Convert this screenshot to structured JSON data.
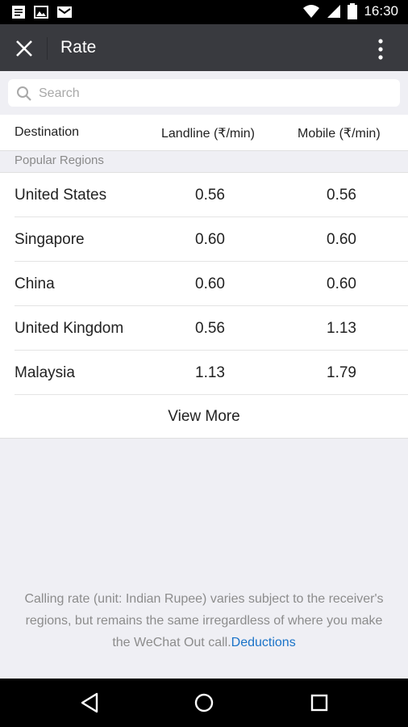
{
  "status_bar": {
    "time": "16:30"
  },
  "app_bar": {
    "title": "Rate"
  },
  "search": {
    "placeholder": "Search"
  },
  "table": {
    "headers": {
      "destination": "Destination",
      "landline": "Landline (₹/min)",
      "mobile": "Mobile (₹/min)"
    },
    "section_label": "Popular Regions",
    "rows": [
      {
        "destination": "United States",
        "landline": "0.56",
        "mobile": "0.56"
      },
      {
        "destination": "Singapore",
        "landline": "0.60",
        "mobile": "0.60"
      },
      {
        "destination": "China",
        "landline": "0.60",
        "mobile": "0.60"
      },
      {
        "destination": "United Kingdom",
        "landline": "0.56",
        "mobile": "1.13"
      },
      {
        "destination": "Malaysia",
        "landline": "1.13",
        "mobile": "1.79"
      }
    ],
    "view_more_label": "View More"
  },
  "footer": {
    "note": "Calling rate (unit: Indian Rupee) varies subject to the receiver's regions, but remains the same irregardless of where you make the WeChat Out call.",
    "link_label": "Deductions"
  },
  "colors": {
    "app_bar": "#393a3f",
    "background": "#efeff4",
    "link": "#1a73c8"
  }
}
